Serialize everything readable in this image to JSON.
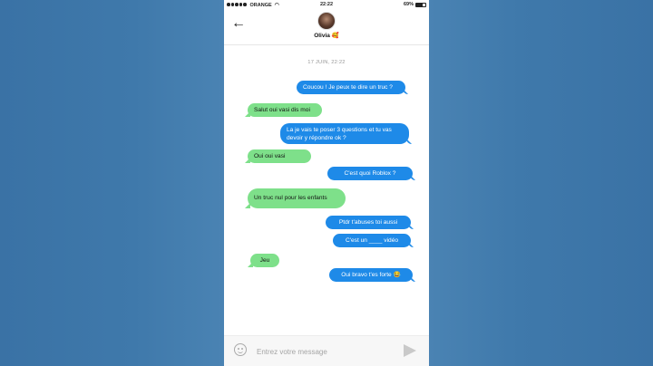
{
  "statusbar": {
    "carrier": "ORANGE",
    "time": "22:22",
    "battery": "69%",
    "battery_level": 0.69
  },
  "header": {
    "contact_name": "Olivia 🥰"
  },
  "conversation": {
    "date": "17 JUIN, 22:22",
    "messages": [
      {
        "from": "me",
        "text": "Coucou ! Je peux te dire un truc ?"
      },
      {
        "from": "them",
        "text": "Salut oui vasi dis moi"
      },
      {
        "from": "me",
        "text": "La je vais te poser 3 questions et tu vas devoir y répondre ok ?"
      },
      {
        "from": "them",
        "text": "Oui oui vasi"
      },
      {
        "from": "me",
        "text": "C'est quoi Roblox ?"
      },
      {
        "from": "them",
        "text": "Un truc nul pour les enfants"
      },
      {
        "from": "me",
        "text": "Ptdr t'abuses toi aussi"
      },
      {
        "from": "me",
        "text": "C'est un ____ vidéo"
      },
      {
        "from": "them",
        "text": "Jeu"
      },
      {
        "from": "me",
        "text": "Oui bravo t'es forte 😂"
      }
    ]
  },
  "composer": {
    "placeholder": "Entrez votre message"
  },
  "colors": {
    "sent_bubble": "#1e8ae8",
    "received_bubble": "#7ee08a",
    "background": "#3d76a8"
  },
  "icons": {
    "back": "back-arrow-icon",
    "emoji": "emoji-icon",
    "send": "send-icon"
  }
}
